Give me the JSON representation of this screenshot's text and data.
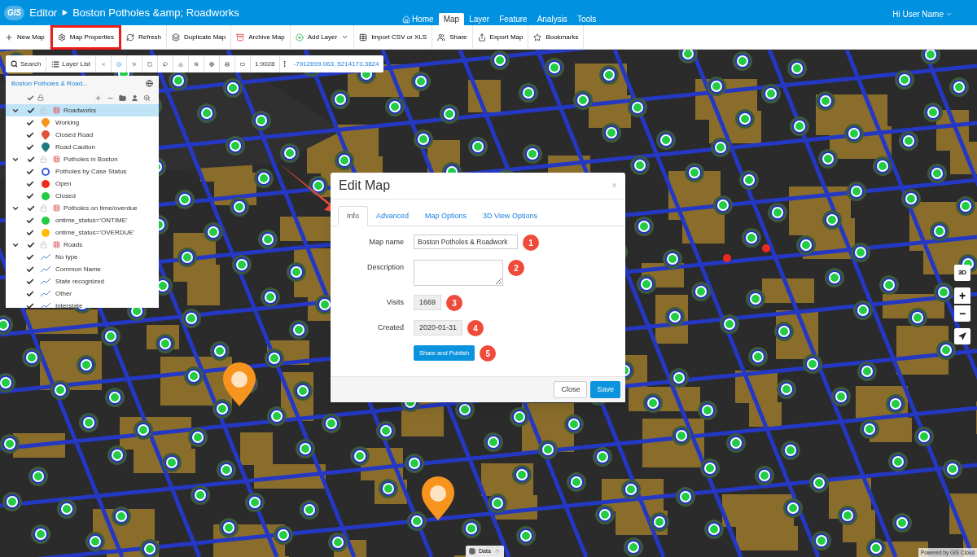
{
  "header": {
    "logo": "GIS",
    "breadcrumb": [
      "Editor",
      "Boston Potholes &amp; Roadworks"
    ],
    "nav": [
      {
        "label": "Home",
        "selected": false
      },
      {
        "label": "Map",
        "selected": true
      },
      {
        "label": "Layer",
        "selected": false
      },
      {
        "label": "Feature",
        "selected": false
      },
      {
        "label": "Analysis",
        "selected": false
      },
      {
        "label": "Tools",
        "selected": false
      }
    ],
    "user": "Hi User Name"
  },
  "toolbar": [
    {
      "label": "New Map",
      "highlighted": false
    },
    {
      "label": "Map Properties",
      "highlighted": true
    },
    {
      "label": "Refresh",
      "highlighted": false
    },
    {
      "label": "Duplicate Map",
      "highlighted": false
    },
    {
      "label": "Archive Map",
      "highlighted": false
    },
    {
      "label": "Add Layer",
      "highlighted": false
    },
    {
      "label": "Import CSV or XLS",
      "highlighted": false
    },
    {
      "label": "Share",
      "highlighted": false
    },
    {
      "label": "Export Map",
      "highlighted": false
    },
    {
      "label": "Bookmarks",
      "highlighted": false
    }
  ],
  "map_toolbar": {
    "search": "Search",
    "layer_list": "Layer List",
    "scale": "1:9028",
    "coordinates": "-7912699.063, 5214173.3824"
  },
  "layer_panel": {
    "title": "Boston Potholes & Road...",
    "layers": [
      {
        "name": "Roadworks",
        "selected": true,
        "checked": true,
        "expanded": true,
        "children": [
          {
            "name": "Working",
            "kind": "pin",
            "color": "#f7941d",
            "checked": true
          },
          {
            "name": "Closed Road",
            "kind": "pin",
            "color": "#e0513a",
            "checked": true
          },
          {
            "name": "Road Caution",
            "kind": "pin",
            "color": "#1f7a7a",
            "checked": true
          }
        ]
      },
      {
        "name": "Potholes in Boston",
        "selected": false,
        "checked": true,
        "expanded": true,
        "children": [
          {
            "name": "Potholes by Case Status",
            "kind": "ring",
            "color": "#3b5bdb",
            "checked": true
          },
          {
            "name": "Open",
            "kind": "dot",
            "color": "#ee2a1e",
            "checked": true
          },
          {
            "name": "Closed",
            "kind": "dot",
            "color": "#22cc44",
            "checked": true
          }
        ]
      },
      {
        "name": "Potholes on time/overdue",
        "selected": false,
        "checked": true,
        "expanded": true,
        "children": [
          {
            "name": "ontime_status='ONTIME'",
            "kind": "dot",
            "color": "#22cc44",
            "checked": true
          },
          {
            "name": "ontime_status='OVERDUE'",
            "kind": "dot",
            "color": "#ffbb00",
            "checked": true
          }
        ]
      },
      {
        "name": "Roads",
        "selected": false,
        "checked": true,
        "expanded": true,
        "children": [
          {
            "name": "No type",
            "kind": "line",
            "color": "#5577dd",
            "checked": true
          },
          {
            "name": "Common Name",
            "kind": "line",
            "color": "#5577dd",
            "checked": true
          },
          {
            "name": "State recognized",
            "kind": "line",
            "color": "#5577dd",
            "checked": true
          },
          {
            "name": "Other",
            "kind": "line",
            "color": "#5577dd",
            "checked": true
          },
          {
            "name": "Interstate",
            "kind": "line",
            "color": "#5577dd",
            "checked": true
          }
        ]
      }
    ]
  },
  "dialog": {
    "title": "Edit Map",
    "close": "×",
    "tabs": [
      {
        "label": "Info",
        "selected": true
      },
      {
        "label": "Advanced",
        "selected": false
      },
      {
        "label": "Map Options",
        "selected": false
      },
      {
        "label": "3D View Options",
        "selected": false
      }
    ],
    "fields": [
      {
        "kind": "text",
        "label": "Map name",
        "value": "Boston Potholes & Roadwork",
        "badge": "1"
      },
      {
        "kind": "textarea",
        "label": "Description",
        "badge": "2"
      },
      {
        "kind": "readonly",
        "label": "Visits",
        "value": "1669",
        "badge": "3"
      },
      {
        "kind": "readonly",
        "label": "Created",
        "value": "2020-01-31",
        "badge": "4"
      },
      {
        "kind": "button",
        "value": "Share and Publish",
        "badge": "5"
      }
    ],
    "buttons": [
      {
        "label": "Close",
        "kind": "default"
      },
      {
        "label": "Save",
        "kind": "primary"
      }
    ]
  },
  "map_controls": {
    "three_d": "3D",
    "zoom_in": "+",
    "zoom_out": "−"
  },
  "data_tab": "Data",
  "attribution": "Powered by GIS Cloud"
}
